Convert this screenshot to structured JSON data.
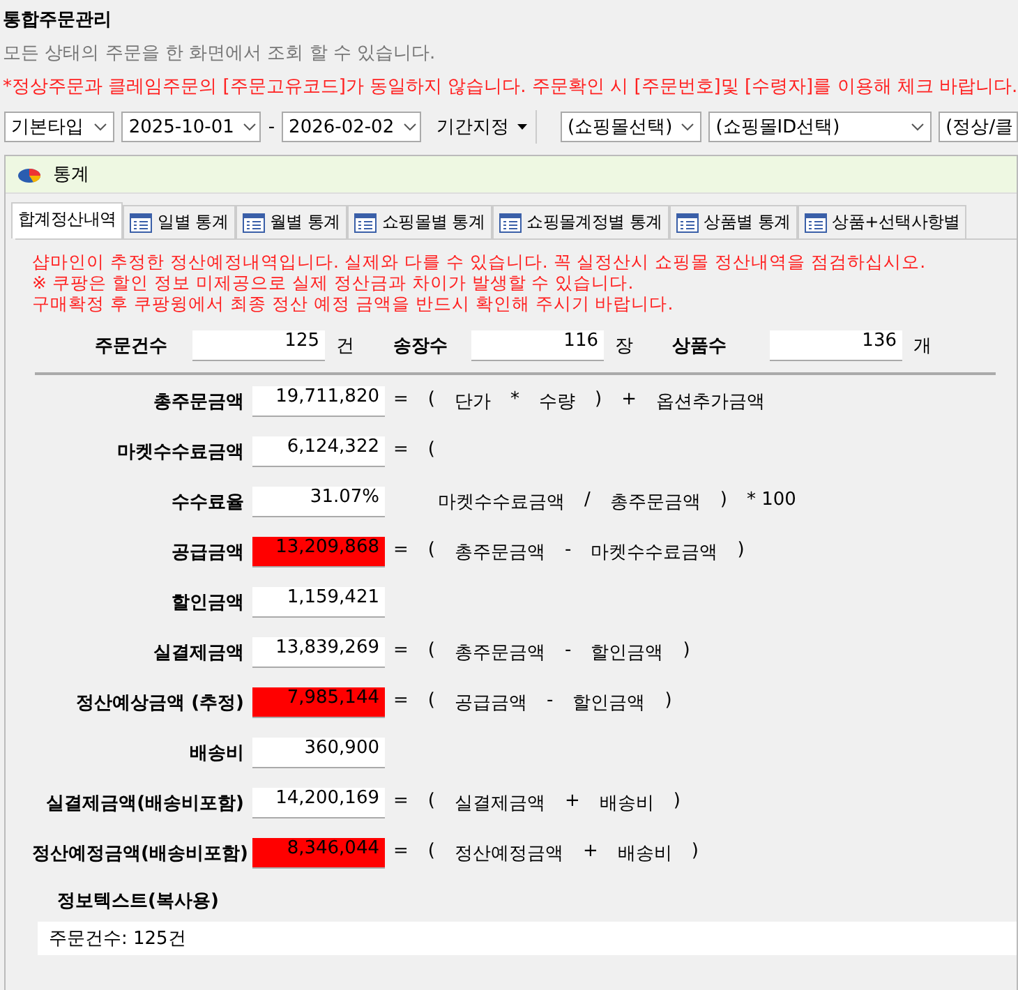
{
  "page": {
    "title": "통합주문관리",
    "subtitle": "모든 상태의 주문을 한 화면에서 조회 할 수 있습니다.",
    "warning": "*정상주문과 클레임주문의 [주문고유코드]가 동일하지 않습니다. 주문확인 시 [주문번호]및 [수령자]를 이용해 체크 바랍니다."
  },
  "filters": [
    {
      "kind": "select",
      "value": "기본타입"
    },
    {
      "kind": "select",
      "value": "2025-10-01"
    },
    {
      "kind": "dash",
      "value": "-"
    },
    {
      "kind": "select",
      "value": "2026-02-02"
    },
    {
      "kind": "menu",
      "value": "기간지정"
    },
    {
      "kind": "select",
      "value": "(쇼핑몰선택)"
    },
    {
      "kind": "select",
      "value": "(쇼핑몰ID선택)"
    },
    {
      "kind": "cut",
      "value": "(정상/클"
    }
  ],
  "dialog": {
    "title": "통계",
    "tabs": [
      {
        "label": "합계정산내역",
        "selected": true
      },
      {
        "label": "일별 통계",
        "selected": false
      },
      {
        "label": "월별 통계",
        "selected": false
      },
      {
        "label": "쇼핑몰별 통계",
        "selected": false
      },
      {
        "label": "쇼핑몰계정별 통계",
        "selected": false
      },
      {
        "label": "상품별 통계",
        "selected": false
      },
      {
        "label": "상품+선택사항별",
        "selected": false
      }
    ],
    "notes": [
      "샵마인이 추정한 정산예정내역입니다. 실제와 다를 수 있습니다. 꼭 실정산시 쇼핑몰 정산내역을 점검하십시오.",
      "※ 쿠팡은 할인 정보 미제공으로 실제 정산금과 차이가 발생할 수 있습니다.",
      "구매확정 후 쿠팡윙에서 최종 정산 예정 금액을 반드시 확인해 주시기 바랍니다."
    ],
    "counts": [
      {
        "label": "주문건수",
        "value": "125",
        "unit": "건"
      },
      {
        "label": "송장수",
        "value": "116",
        "unit": "장"
      },
      {
        "label": "상품수",
        "value": "136",
        "unit": "개"
      }
    ],
    "rows": [
      {
        "label": "총주문금액",
        "value": "19,711,820",
        "highlight": false,
        "continued": false,
        "formula": [
          "=",
          "(",
          "단가",
          "*",
          "수량",
          ")",
          "+",
          "옵션추가금액"
        ]
      },
      {
        "label": "마켓수수료금액",
        "value": "6,124,322",
        "highlight": false,
        "continued": false,
        "formula": [
          "=",
          "("
        ]
      },
      {
        "label": "수수료율",
        "value": "31.07%",
        "highlight": false,
        "continued": true,
        "formula": [
          "마켓수수료금액",
          "/",
          "총주문금액",
          ")",
          "* 100"
        ]
      },
      {
        "label": "공급금액",
        "value": "13,209,868",
        "highlight": true,
        "continued": false,
        "formula": [
          "=",
          "(",
          "총주문금액",
          "-",
          "마켓수수료금액",
          ")"
        ]
      },
      {
        "label": "할인금액",
        "value": "1,159,421",
        "highlight": false,
        "continued": false,
        "formula": []
      },
      {
        "label": "실결제금액",
        "value": "13,839,269",
        "highlight": false,
        "continued": false,
        "formula": [
          "=",
          "(",
          "총주문금액",
          "-",
          "할인금액",
          ")"
        ]
      },
      {
        "label": "정산예상금액 (추정)",
        "value": "7,985,144",
        "highlight": true,
        "continued": false,
        "formula": [
          "=",
          "(",
          "공급금액",
          "-",
          "할인금액",
          ")"
        ]
      },
      {
        "label": "배송비",
        "value": "360,900",
        "highlight": false,
        "continued": false,
        "formula": []
      },
      {
        "label": "실결제금액(배송비포함)",
        "value": "14,200,169",
        "highlight": false,
        "continued": false,
        "formula": [
          "=",
          "(",
          "실결제금액",
          "+",
          "배송비",
          ")"
        ]
      },
      {
        "label": "정산예정금액(배송비포함)",
        "value": "8,346,044",
        "highlight": true,
        "continued": false,
        "formula": [
          "=",
          "(",
          "정산예정금액",
          "+",
          "배송비",
          ")"
        ]
      }
    ],
    "info_label": "정보텍스트(복사용)",
    "info_text": "주문건수: 125건"
  }
}
